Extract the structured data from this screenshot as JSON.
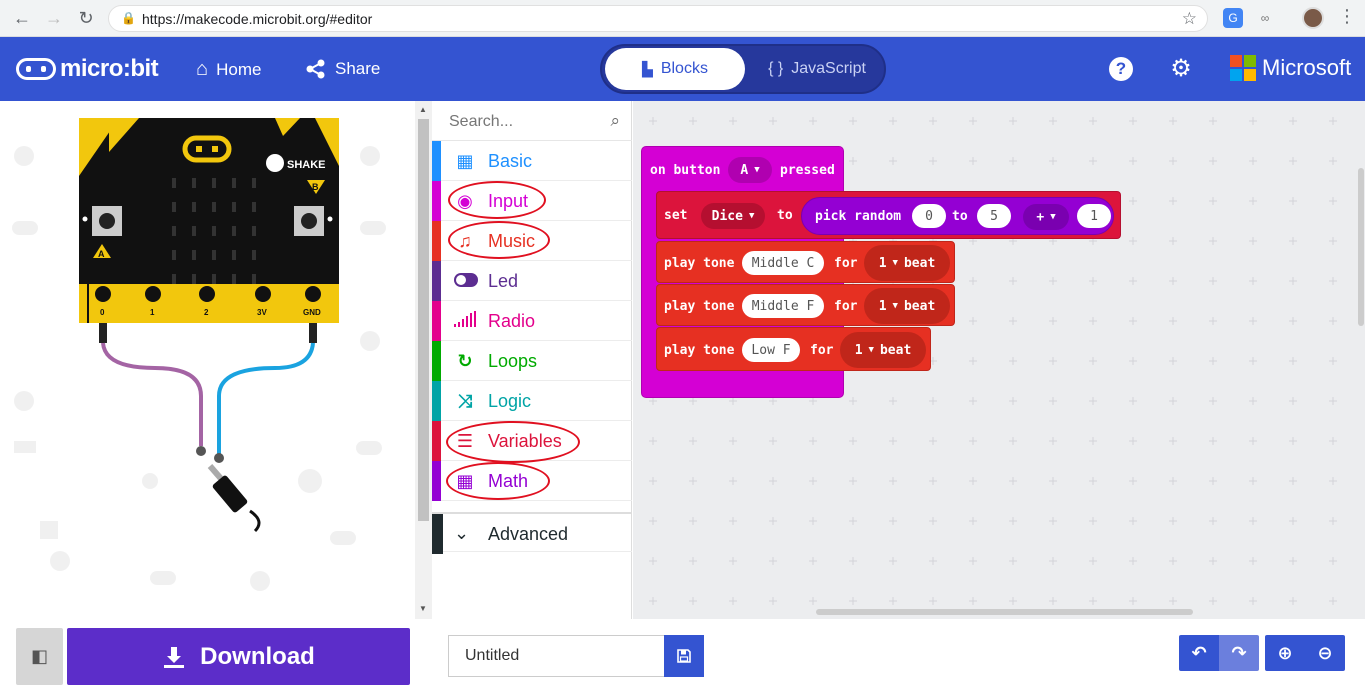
{
  "browser": {
    "url": "https://makecode.microbit.org/#editor",
    "back_icon": "←",
    "forward_icon": "→",
    "reload_icon": "↻",
    "lock_icon": "🔒",
    "star_icon": "☆",
    "menu_icon": "⋮"
  },
  "topbar": {
    "logo": "micro:bit",
    "home_label": "Home",
    "share_label": "Share",
    "blocks_label": "Blocks",
    "javascript_label": "JavaScript",
    "help_icon": "?",
    "microsoft_label": "Microsoft",
    "brand_color": "#3454d1"
  },
  "simulator": {
    "shake_label": "SHAKE",
    "button_a": "A",
    "button_b": "B",
    "pins": [
      "0",
      "1",
      "2",
      "3V",
      "GND"
    ]
  },
  "toolbox": {
    "search_placeholder": "Search...",
    "categories": [
      {
        "label": "Basic",
        "color": "#1e90ff"
      },
      {
        "label": "Input",
        "color": "#d400d4"
      },
      {
        "label": "Music",
        "color": "#e63022"
      },
      {
        "label": "Led",
        "color": "#5c2d91"
      },
      {
        "label": "Radio",
        "color": "#e3008c"
      },
      {
        "label": "Loops",
        "color": "#00aa00"
      },
      {
        "label": "Logic",
        "color": "#00a4a6"
      },
      {
        "label": "Variables",
        "color": "#dc143c"
      },
      {
        "label": "Math",
        "color": "#9400d3"
      }
    ],
    "advanced_label": "Advanced"
  },
  "workspace": {
    "event_block": {
      "prefix": "on button",
      "button": "A",
      "suffix": "pressed"
    },
    "set_block": {
      "keyword": "set",
      "variable": "Dice",
      "to": "to",
      "fn": "pick random",
      "min": "0",
      "to2": "to",
      "max": "5",
      "op": "+",
      "addend": "1"
    },
    "tone_blocks": [
      {
        "keyword": "play tone",
        "note": "Middle C",
        "for": "for",
        "beats": "1",
        "unit": "beat"
      },
      {
        "keyword": "play tone",
        "note": "Middle F",
        "for": "for",
        "beats": "1",
        "unit": "beat"
      },
      {
        "keyword": "play tone",
        "note": "Low F",
        "for": "for",
        "beats": "1",
        "unit": "beat"
      }
    ]
  },
  "bottombar": {
    "download_label": "Download",
    "project_name": "Untitled"
  }
}
